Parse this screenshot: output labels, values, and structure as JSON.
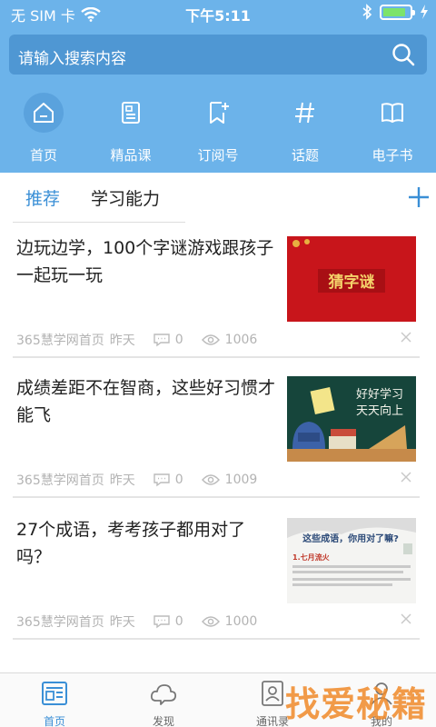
{
  "status": {
    "carrier": "无 SIM 卡",
    "time": "下午5:11",
    "battery_level": 0.85,
    "icons": [
      "wifi-icon",
      "bluetooth-icon",
      "battery-icon",
      "charging-icon"
    ]
  },
  "search": {
    "placeholder": "请输入搜索内容"
  },
  "nav": {
    "items": [
      {
        "label": "首页",
        "icon": "home-icon",
        "active": true
      },
      {
        "label": "精品课",
        "icon": "course-icon",
        "active": false
      },
      {
        "label": "订阅号",
        "icon": "bookmark-add-icon",
        "active": false
      },
      {
        "label": "话题",
        "icon": "hashtag-icon",
        "active": false
      },
      {
        "label": "电子书",
        "icon": "book-icon",
        "active": false
      }
    ]
  },
  "tabs": {
    "items": [
      "推荐",
      "学习能力"
    ],
    "active": 0
  },
  "feed": {
    "items": [
      {
        "title": "边玩边学，100个字谜游戏跟孩子一起玩一玩",
        "source": "365慧学网首页",
        "time": "昨天",
        "comments": "0",
        "views": "1006",
        "thumb_text": "猜字谜"
      },
      {
        "title": "成绩差距不在智商，这些好习惯才能飞",
        "source": "365慧学网首页",
        "time": "昨天",
        "comments": "0",
        "views": "1009",
        "thumb_text_line1": "好好学习",
        "thumb_text_line2": "天天向上"
      },
      {
        "title": "27个成语，考考孩子都用对了吗？",
        "source": "365慧学网首页",
        "time": "昨天",
        "comments": "0",
        "views": "1000",
        "thumb_text": "这些成语，你用对了嘛?",
        "thumb_sub": "1.七月流火"
      }
    ]
  },
  "bottom_nav": {
    "items": [
      {
        "label": "首页",
        "icon": "newspaper-icon",
        "active": true
      },
      {
        "label": "发现",
        "icon": "cloud-icon",
        "active": false
      },
      {
        "label": "通讯录",
        "icon": "contacts-icon",
        "active": false
      },
      {
        "label": "我的",
        "icon": "profile-icon",
        "active": false
      }
    ]
  },
  "watermark": "找爱秘籍",
  "colors": {
    "header": "#6cb3ea",
    "accent": "#3a8fd6",
    "search_bg": "#4f97d3"
  }
}
